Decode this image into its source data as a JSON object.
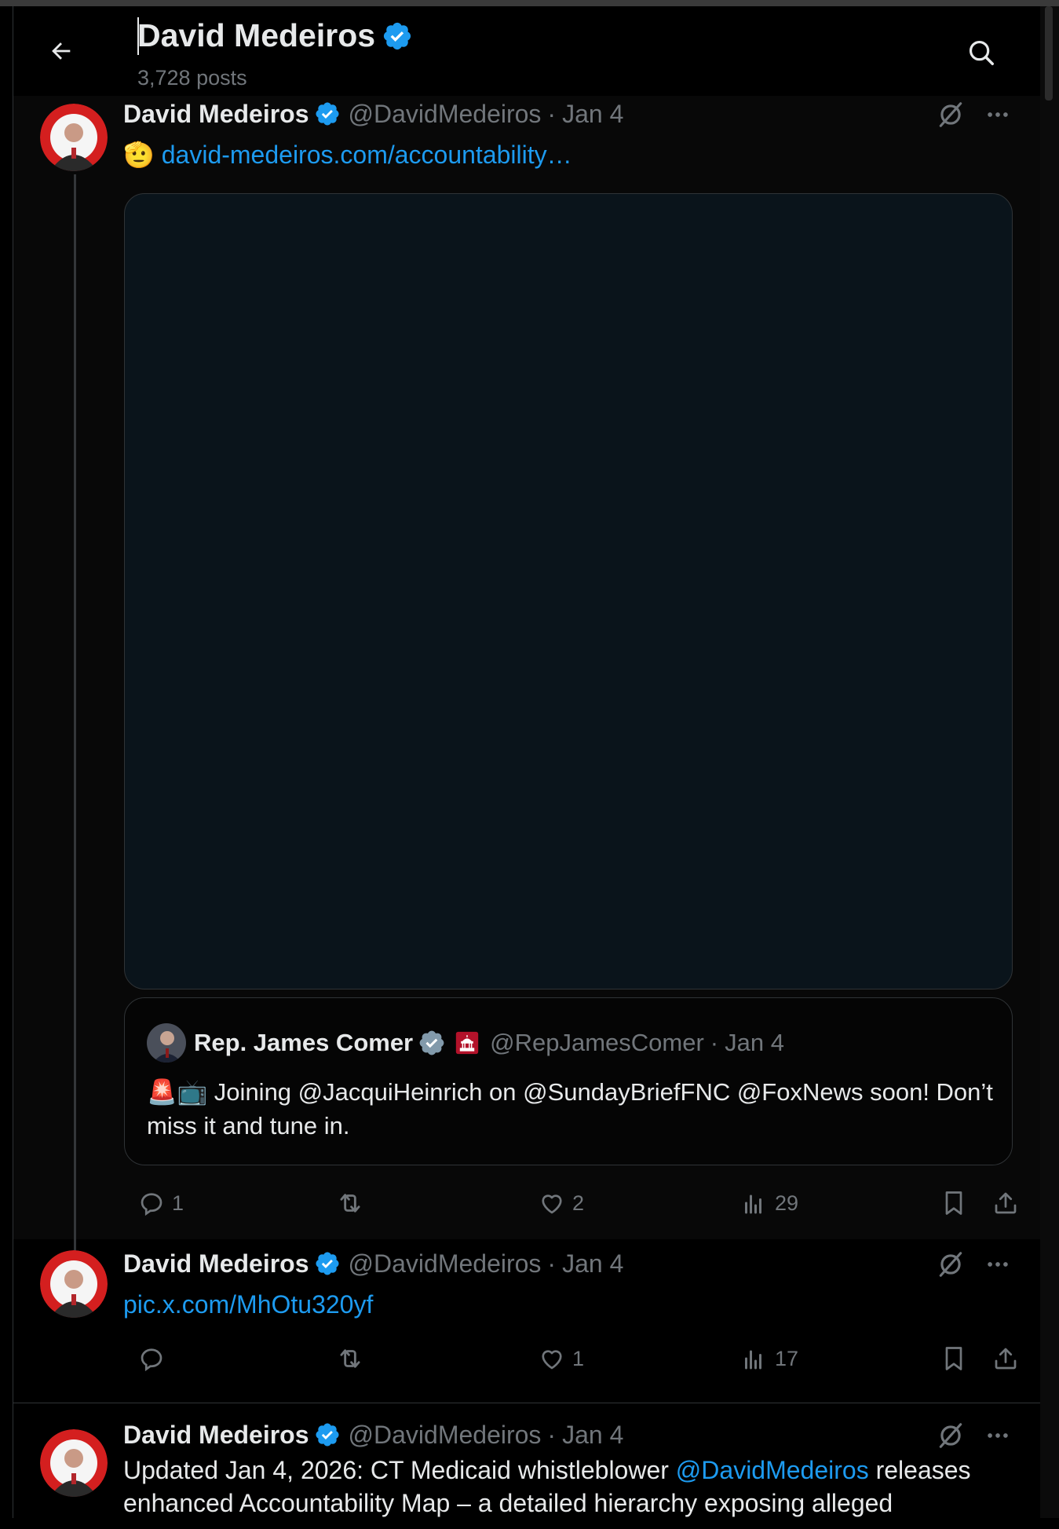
{
  "header": {
    "title": "David Medeiros",
    "posts_count": "3,728 posts"
  },
  "colors": {
    "accent": "#1d9bf0",
    "muted": "#71767b",
    "text": "#e7e9ea",
    "background": "#000000",
    "border": "#2f3336"
  },
  "posts": [
    {
      "name": "David Medeiros",
      "handle": "@DavidMedeiros",
      "sep": "·",
      "time": "Jan 4",
      "emoji": "🫡",
      "link": "david-medeiros.com/accountability…",
      "quote": {
        "name": "Rep. James Comer",
        "handle": "@RepJamesComer",
        "sep": "·",
        "time": "Jan 4",
        "text": "🚨📺 Joining @JacquiHeinrich on @SundayBriefFNC @FoxNews soon! Don’t miss it and tune in."
      },
      "stats": {
        "replies": "1",
        "reposts": "",
        "likes": "2",
        "views": "29"
      }
    },
    {
      "name": "David Medeiros",
      "handle": "@DavidMedeiros",
      "sep": "·",
      "time": "Jan 4",
      "link": "pic.x.com/MhOtu320yf",
      "stats": {
        "replies": "",
        "reposts": "",
        "likes": "1",
        "views": "17"
      }
    },
    {
      "name": "David Medeiros",
      "handle": "@DavidMedeiros",
      "sep": "·",
      "time": "Jan 4",
      "text_before": "Updated Jan 4, 2026: CT Medicaid whistleblower ",
      "mention": "@DavidMedeiros",
      "text_after": " releases enhanced Accountability Map – a detailed hierarchy exposing alleged"
    }
  ],
  "icons": [
    "back-arrow-icon",
    "search-icon",
    "verified-badge-icon",
    "grok-icon",
    "more-icon",
    "reply-icon",
    "repost-icon",
    "like-icon",
    "views-icon",
    "bookmark-icon",
    "share-icon",
    "capitol-icon"
  ]
}
